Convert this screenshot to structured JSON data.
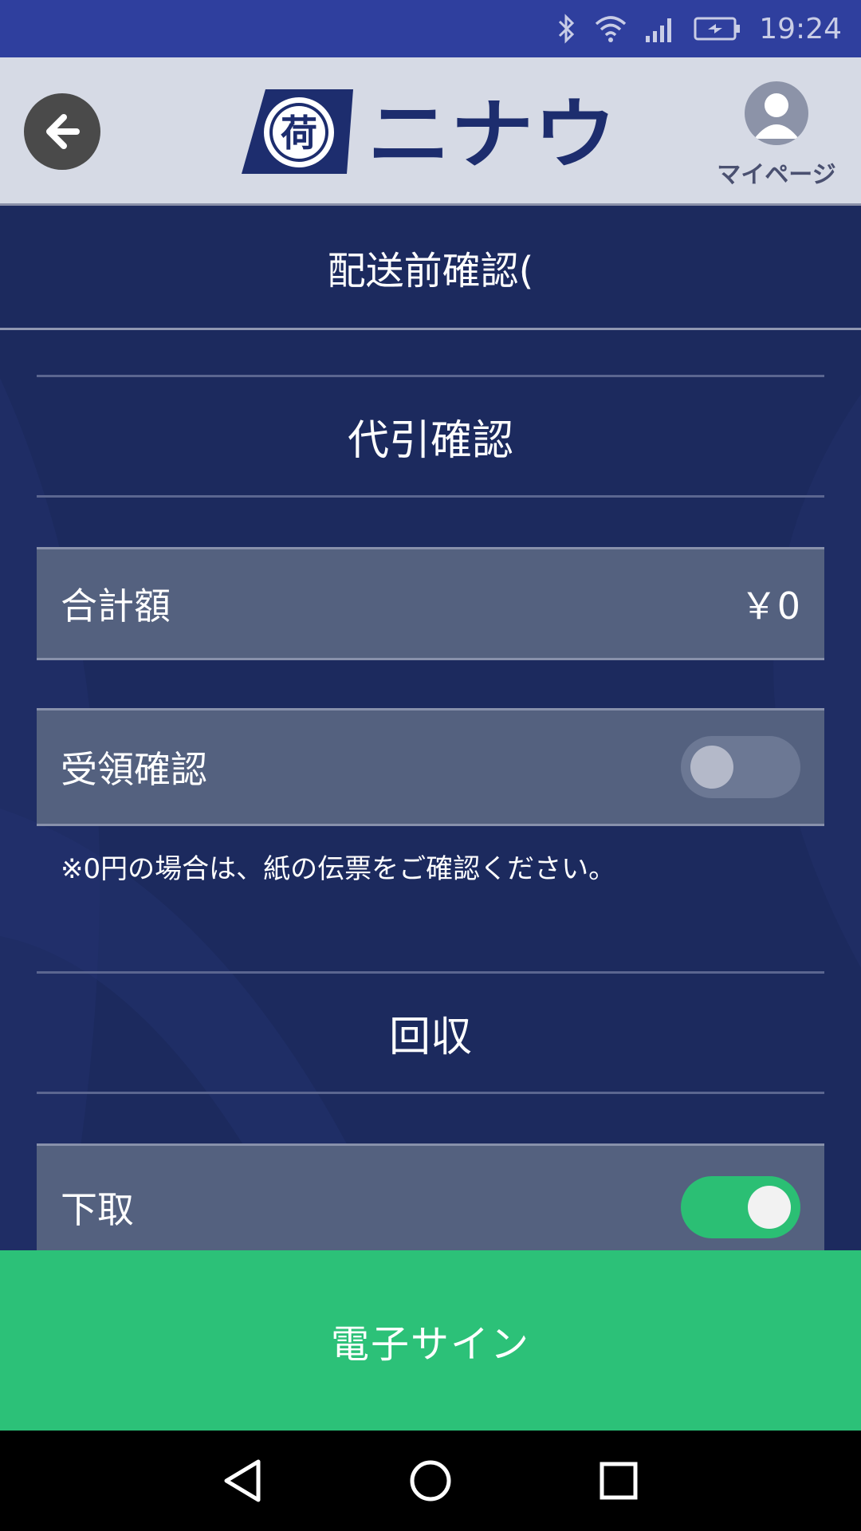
{
  "status_bar": {
    "time": "19:24"
  },
  "header": {
    "logo_mark": "荷",
    "logo_text": "ニナウ",
    "mypage_label": "マイページ"
  },
  "title": "配送前確認(",
  "sections": {
    "cod": {
      "heading": "代引確認",
      "total_label": "合計額",
      "total_value": "￥0",
      "receipt_label": "受領確認",
      "receipt_toggle": false,
      "note": "※0円の場合は、紙の伝票をご確認ください。"
    },
    "collect": {
      "heading": "回収",
      "tradein_label": "下取",
      "tradein_toggle": true
    }
  },
  "actions": {
    "sign_label": "電子サイン"
  },
  "colors": {
    "status_bar": "#2f3f9e",
    "header_bg": "#d6dae5",
    "main_bg": "#1c2a5e",
    "row_bg": "#54617f",
    "accent_green": "#2cc178",
    "logo_navy": "#1d2d6e"
  }
}
